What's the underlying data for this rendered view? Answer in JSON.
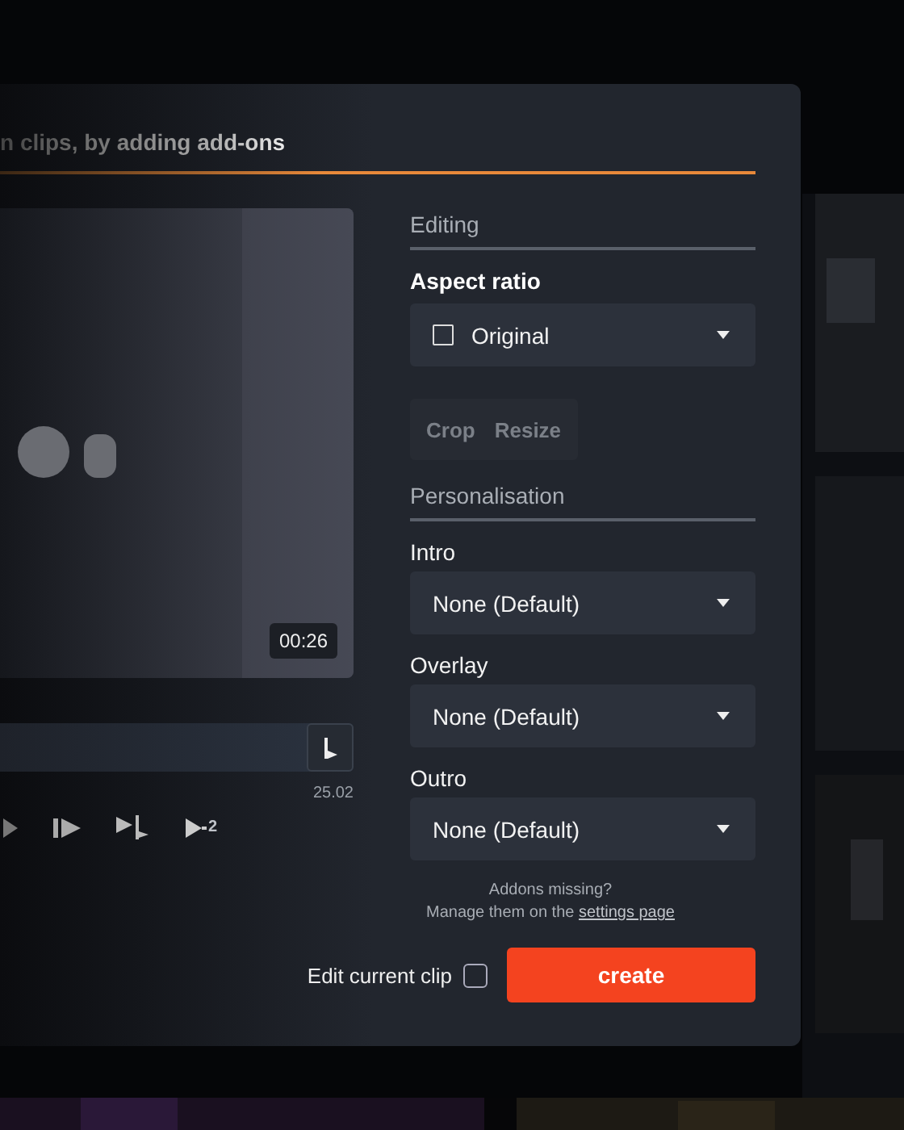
{
  "dialog": {
    "title": "n clips, by adding add-ons"
  },
  "preview": {
    "kind": "picture",
    "duration": "00:26"
  },
  "timeline": {
    "reading": "25.02"
  },
  "controls": [
    {
      "kind": "play"
    },
    {
      "kind": "frame"
    },
    {
      "kind": "marker"
    },
    {
      "kind": "speed",
      "label": "2"
    }
  ],
  "editing": {
    "heading": "Editing",
    "aspect_label": "Aspect ratio",
    "aspect_value": "Original",
    "tools": [
      {
        "label": "Crop",
        "disabled": true
      },
      {
        "label": "Resize",
        "disabled": true
      }
    ]
  },
  "personalisation": {
    "heading": "Personalisation",
    "selects": [
      {
        "label": "Intro",
        "value": "None (Default)"
      },
      {
        "label": "Overlay",
        "value": "None (Default)"
      },
      {
        "label": "Outro",
        "value": "None (Default)"
      }
    ]
  },
  "hint": {
    "line1": "Addons missing?",
    "line2": "Manage them on the ",
    "link": "settings page"
  },
  "edit_current": {
    "label": "Edit current clip",
    "checked": false
  },
  "create_button": "create"
}
